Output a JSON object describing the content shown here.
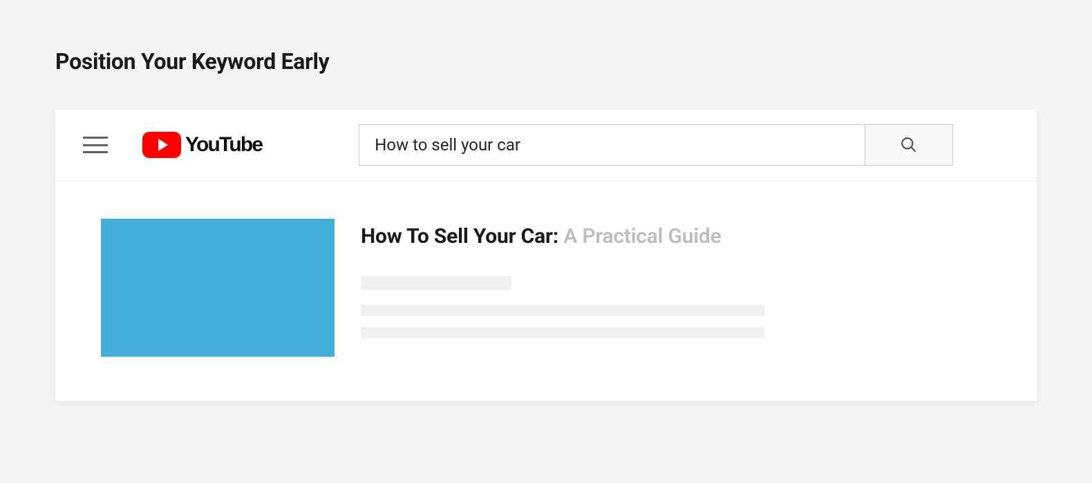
{
  "heading": "Position Your Keyword Early",
  "youtube": {
    "brand": "YouTube",
    "search_value": "How to sell your car",
    "search_placeholder": "Search"
  },
  "result": {
    "title_bold": "How To Sell Your Car: ",
    "title_rest": "A Practical Guide",
    "thumbnail_color": "#44aedb"
  }
}
